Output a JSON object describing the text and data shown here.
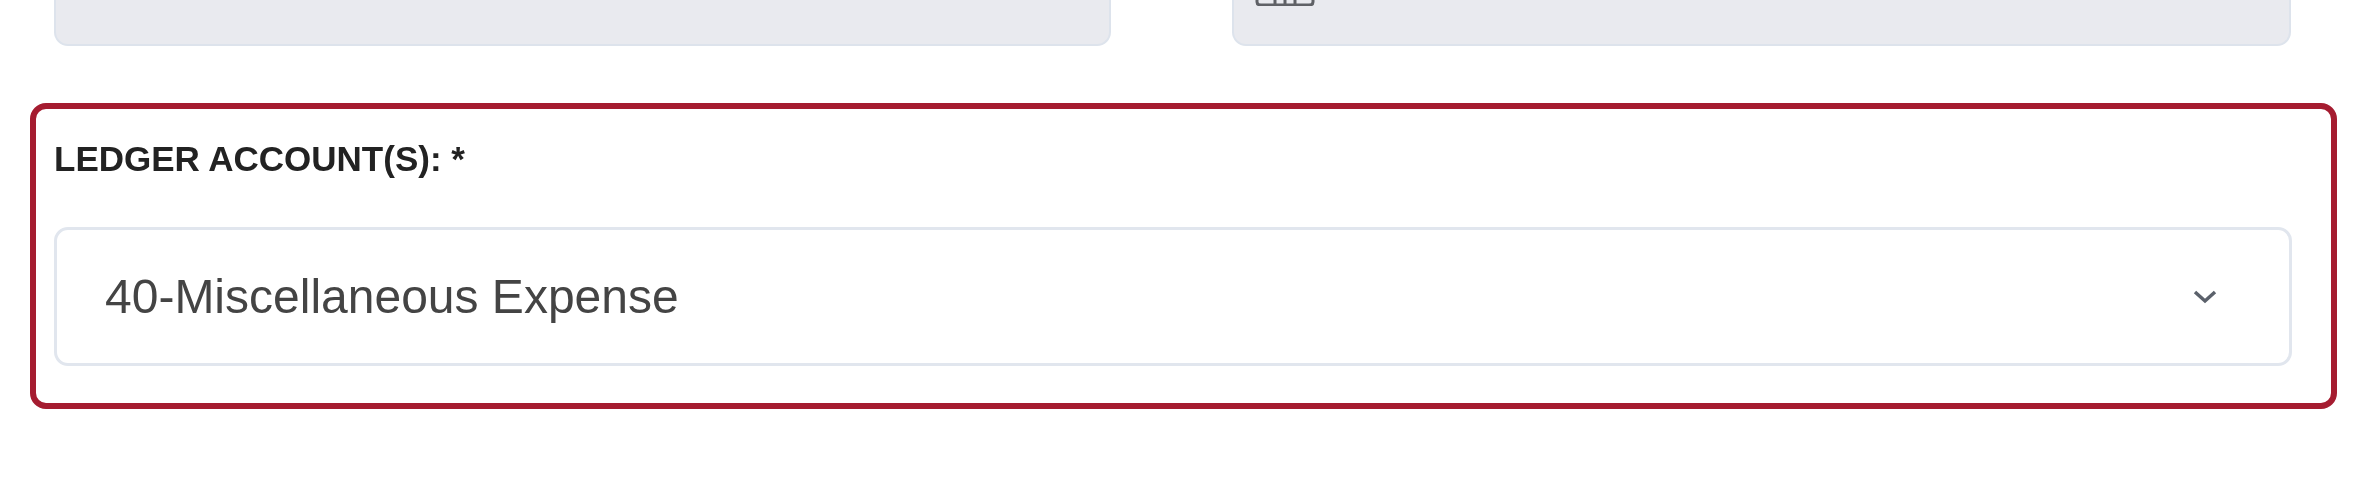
{
  "ledger_field": {
    "label": "LEDGER ACCOUNT(S): *",
    "value": "40-Miscellaneous Expense"
  }
}
